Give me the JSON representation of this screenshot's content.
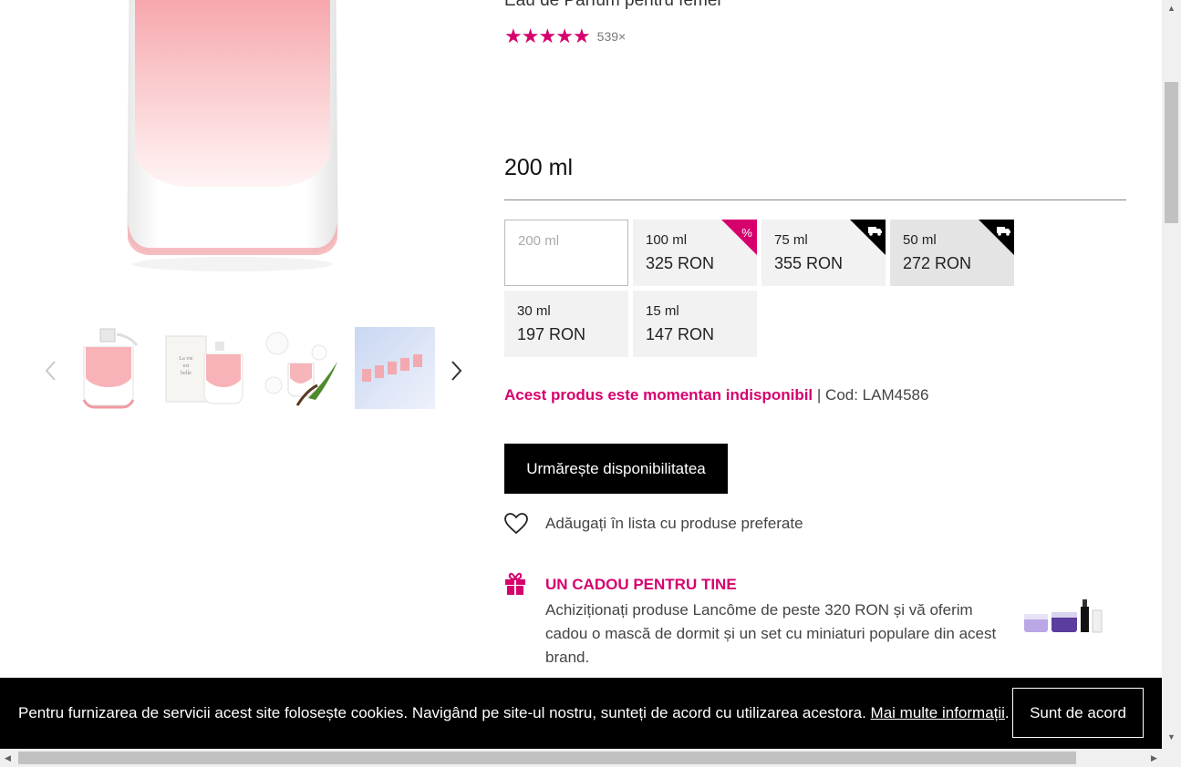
{
  "product": {
    "subtitle": "Eau de Parfum pentru femei",
    "rating_count": "539×"
  },
  "size": {
    "title": "200 ml",
    "variants": [
      {
        "size": "200 ml",
        "price": "",
        "badge": "",
        "state": "selected"
      },
      {
        "size": "100 ml",
        "price": "325 RON",
        "badge": "percent-icon",
        "state": "normal"
      },
      {
        "size": "75 ml",
        "price": "355 RON",
        "badge": "delivery-truck-icon",
        "state": "normal"
      },
      {
        "size": "50 ml",
        "price": "272 RON",
        "badge": "delivery-truck-icon",
        "state": "hover"
      },
      {
        "size": "30 ml",
        "price": "197 RON",
        "badge": "",
        "state": "normal"
      },
      {
        "size": "15 ml",
        "price": "147 RON",
        "badge": "",
        "state": "normal"
      }
    ]
  },
  "availability": {
    "status": "Acest produs este momentan indisponibil",
    "separator": " | ",
    "code": "Cod: LAM4586"
  },
  "actions": {
    "watch_label": "Urmărește disponibilitatea",
    "wishlist_label": "Adăugați în lista cu produse preferate"
  },
  "gift": {
    "title": "UN CADOU PENTRU TINE",
    "text": "Achiziționați produse Lancôme de peste 320 RON și vă oferim cadou o mască de dormit și un set cu miniaturi populare din acest brand."
  },
  "cookie": {
    "text": "Pentru furnizarea de servicii acest site folosește cookies. Navigând pe site-ul nostru, sunteți de acord cu utilizarea acestora. ",
    "link": "Mai multe informații",
    "after_link": ".",
    "accept_label": "Sunt de acord"
  },
  "colors": {
    "accent": "#d6006d",
    "button_bg": "#000000",
    "tile_bg": "#f2f2f2"
  }
}
